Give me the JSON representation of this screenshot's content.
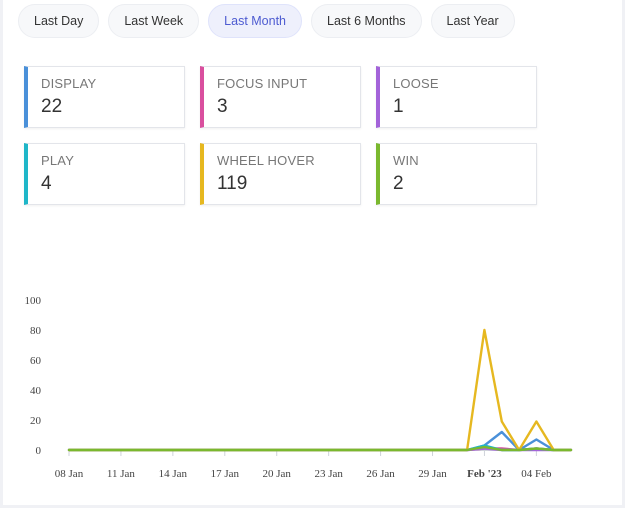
{
  "range_buttons": [
    {
      "label": "Last Day",
      "active": false
    },
    {
      "label": "Last Week",
      "active": false
    },
    {
      "label": "Last Month",
      "active": true
    },
    {
      "label": "Last 6 Months",
      "active": false
    },
    {
      "label": "Last Year",
      "active": false
    }
  ],
  "stats": [
    {
      "label": "DISPLAY",
      "value": "22",
      "color": "#4a90d9"
    },
    {
      "label": "FOCUS INPUT",
      "value": "3",
      "color": "#d94f9e"
    },
    {
      "label": "LOOSE",
      "value": "1",
      "color": "#a363d9"
    },
    {
      "label": "PLAY",
      "value": "4",
      "color": "#1fb6c8"
    },
    {
      "label": "WHEEL HOVER",
      "value": "119",
      "color": "#e6b820"
    },
    {
      "label": "WIN",
      "value": "2",
      "color": "#7ab82e"
    }
  ],
  "chart_data": {
    "type": "line",
    "y_ticks": [
      "100",
      "80",
      "60",
      "40",
      "20",
      "0"
    ],
    "ylim": [
      0,
      100
    ],
    "x_tick_labels": [
      "08 Jan",
      "11 Jan",
      "14 Jan",
      "17 Jan",
      "20 Jan",
      "23 Jan",
      "26 Jan",
      "29 Jan",
      "Feb '23",
      "04 Feb"
    ],
    "x_tick_days": [
      8,
      11,
      14,
      17,
      20,
      23,
      26,
      29,
      32,
      35
    ],
    "x_range_days": [
      8,
      37
    ],
    "x_days": [
      8,
      9,
      10,
      11,
      12,
      13,
      14,
      15,
      16,
      17,
      18,
      19,
      20,
      21,
      22,
      23,
      24,
      25,
      26,
      27,
      28,
      29,
      30,
      31,
      32,
      33,
      34,
      35,
      36,
      37
    ],
    "series": [
      {
        "name": "DISPLAY",
        "color": "#4a90d9",
        "values": [
          0,
          0,
          0,
          0,
          0,
          0,
          0,
          0,
          0,
          0,
          0,
          0,
          0,
          0,
          0,
          0,
          0,
          0,
          0,
          0,
          0,
          0,
          0,
          0,
          3,
          12,
          0,
          7,
          0,
          0
        ]
      },
      {
        "name": "FOCUS INPUT",
        "color": "#d94f9e",
        "values": [
          0,
          0,
          0,
          0,
          0,
          0,
          0,
          0,
          0,
          0,
          0,
          0,
          0,
          0,
          0,
          0,
          0,
          0,
          0,
          0,
          0,
          0,
          0,
          0,
          1,
          1,
          0,
          1,
          0,
          0
        ]
      },
      {
        "name": "LOOSE",
        "color": "#a363d9",
        "values": [
          0,
          0,
          0,
          0,
          0,
          0,
          0,
          0,
          0,
          0,
          0,
          0,
          0,
          0,
          0,
          0,
          0,
          0,
          0,
          0,
          0,
          0,
          0,
          0,
          1,
          0,
          0,
          0,
          0,
          0
        ]
      },
      {
        "name": "PLAY",
        "color": "#1fb6c8",
        "values": [
          0,
          0,
          0,
          0,
          0,
          0,
          0,
          0,
          0,
          0,
          0,
          0,
          0,
          0,
          0,
          0,
          0,
          0,
          0,
          0,
          0,
          0,
          0,
          0,
          3,
          0,
          0,
          1,
          0,
          0
        ]
      },
      {
        "name": "WHEEL HOVER",
        "color": "#e6b820",
        "values": [
          0,
          0,
          0,
          0,
          0,
          0,
          0,
          0,
          0,
          0,
          0,
          0,
          0,
          0,
          0,
          0,
          0,
          0,
          0,
          0,
          0,
          0,
          0,
          0,
          80,
          19,
          0,
          19,
          0,
          0
        ]
      },
      {
        "name": "WIN",
        "color": "#7ab82e",
        "values": [
          0,
          0,
          0,
          0,
          0,
          0,
          0,
          0,
          0,
          0,
          0,
          0,
          0,
          0,
          0,
          0,
          0,
          0,
          0,
          0,
          0,
          0,
          0,
          0,
          2,
          0,
          0,
          1,
          0,
          0
        ]
      }
    ]
  }
}
